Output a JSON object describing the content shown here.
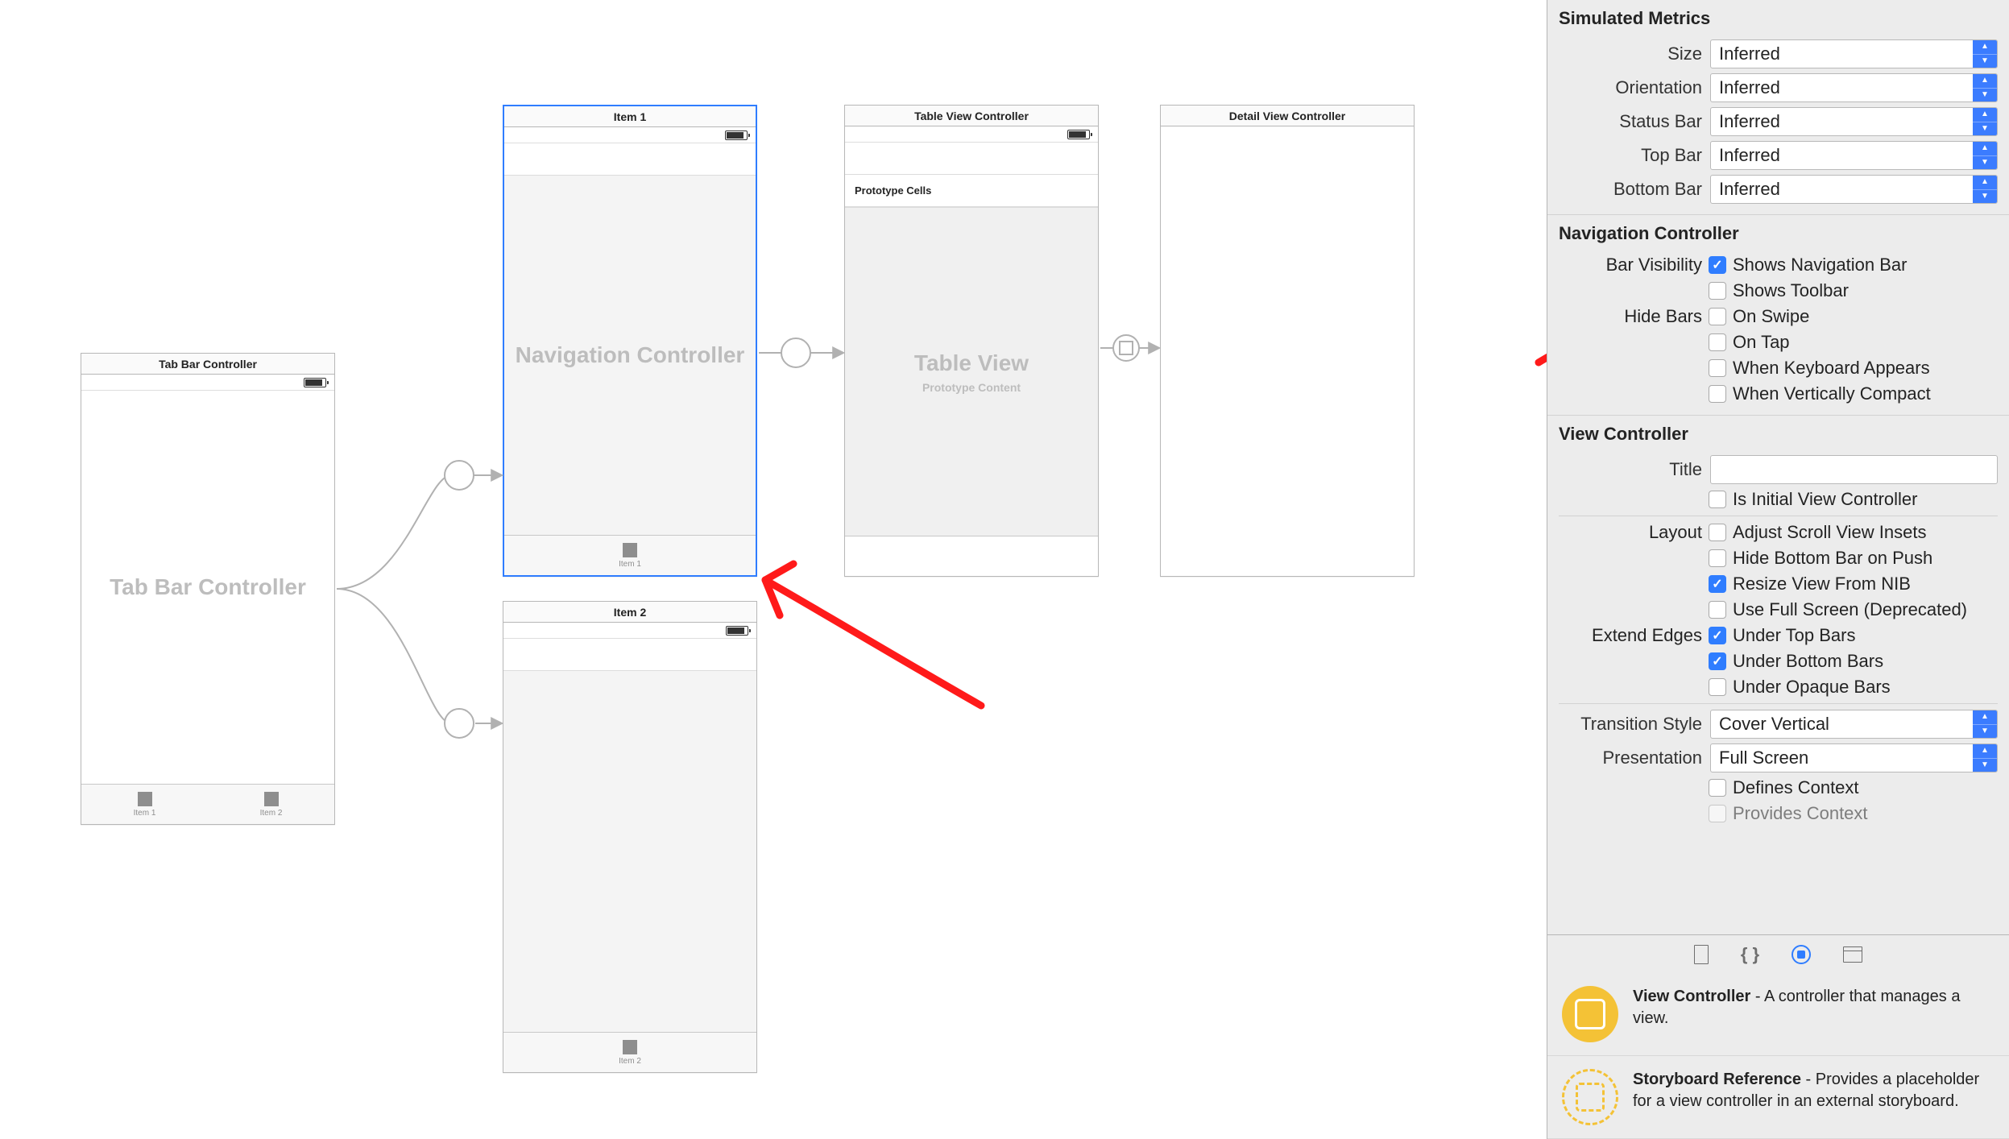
{
  "canvas": {
    "tabBarController": {
      "title": "Tab Bar Controller",
      "ghost": "Tab Bar Controller",
      "tabs": [
        "Item 1",
        "Item 2"
      ]
    },
    "navController": {
      "title": "Item 1",
      "ghost": "Navigation Controller",
      "tabLabel": "Item 1"
    },
    "navController2": {
      "title": "Item 2",
      "tabLabel": "Item 2"
    },
    "tableView": {
      "title": "Table View Controller",
      "prototype": "Prototype Cells",
      "ghost": "Table View",
      "ghostSub": "Prototype Content"
    },
    "detail": {
      "title": "Detail View Controller"
    }
  },
  "inspector": {
    "simulatedMetrics": {
      "title": "Simulated Metrics",
      "rows": {
        "size": {
          "label": "Size",
          "value": "Inferred"
        },
        "orientation": {
          "label": "Orientation",
          "value": "Inferred"
        },
        "statusBar": {
          "label": "Status Bar",
          "value": "Inferred"
        },
        "topBar": {
          "label": "Top Bar",
          "value": "Inferred"
        },
        "bottomBar": {
          "label": "Bottom Bar",
          "value": "Inferred"
        }
      }
    },
    "navigationController": {
      "title": "Navigation Controller",
      "barVisibilityLabel": "Bar Visibility",
      "hideBarsLabel": "Hide Bars",
      "checks": {
        "showsNavBar": {
          "label": "Shows Navigation Bar",
          "checked": true
        },
        "showsToolbar": {
          "label": "Shows Toolbar",
          "checked": false
        },
        "onSwipe": {
          "label": "On Swipe",
          "checked": false
        },
        "onTap": {
          "label": "On Tap",
          "checked": false
        },
        "whenKeyboard": {
          "label": "When Keyboard Appears",
          "checked": false
        },
        "whenCompact": {
          "label": "When Vertically Compact",
          "checked": false
        }
      }
    },
    "viewController": {
      "title": "View Controller",
      "titleLabel": "Title",
      "isInitial": {
        "label": "Is Initial View Controller",
        "checked": false
      },
      "layoutLabel": "Layout",
      "layoutChecks": {
        "adjustInsets": {
          "label": "Adjust Scroll View Insets",
          "checked": false
        },
        "hideBottom": {
          "label": "Hide Bottom Bar on Push",
          "checked": false
        },
        "resizeNib": {
          "label": "Resize View From NIB",
          "checked": true
        },
        "fullScreenDep": {
          "label": "Use Full Screen (Deprecated)",
          "checked": false
        }
      },
      "extendLabel": "Extend Edges",
      "extendChecks": {
        "underTop": {
          "label": "Under Top Bars",
          "checked": true
        },
        "underBottom": {
          "label": "Under Bottom Bars",
          "checked": true
        },
        "underOpaque": {
          "label": "Under Opaque Bars",
          "checked": false
        }
      },
      "transition": {
        "label": "Transition Style",
        "value": "Cover Vertical"
      },
      "presentation": {
        "label": "Presentation",
        "value": "Full Screen"
      },
      "defines": {
        "label": "Defines Context",
        "checked": false
      },
      "provides": {
        "label": "Provides Context",
        "checked": false
      }
    },
    "library": {
      "vc": {
        "name": "View Controller",
        "desc": " - A controller that manages a view."
      },
      "sbref": {
        "name": "Storyboard Reference",
        "desc": " - Provides a placeholder for a view controller in an external storyboard."
      }
    }
  }
}
